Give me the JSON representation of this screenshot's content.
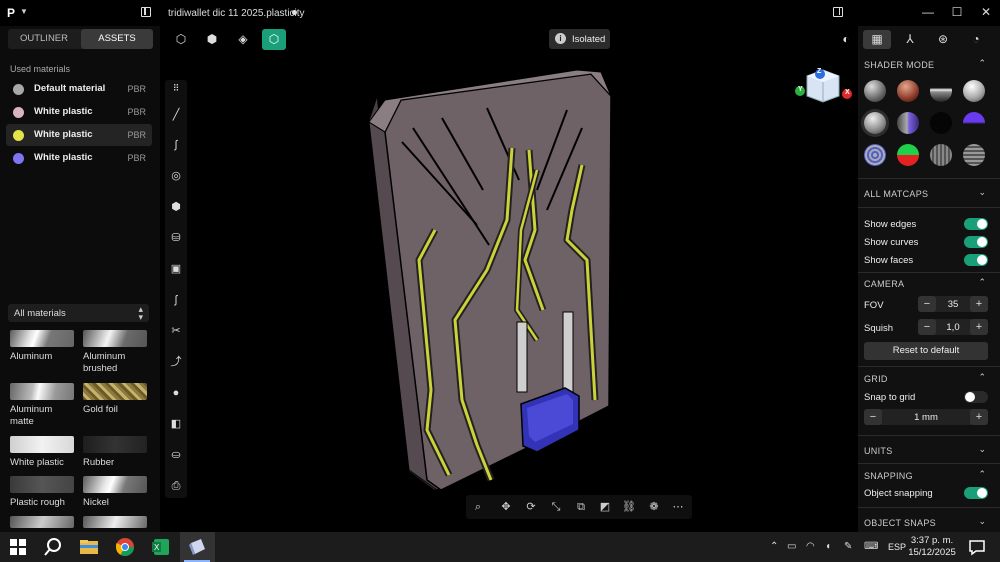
{
  "titlebar": {
    "logo": "P",
    "doc_title": "tridiwallet dic 11 2025.plasticity",
    "min": "—",
    "max": "☐",
    "close": "✕"
  },
  "left_panel": {
    "tabs": [
      {
        "label": "OUTLINER"
      },
      {
        "label": "ASSETS"
      }
    ],
    "used_materials_title": "Used materials",
    "used_materials": [
      {
        "name": "Default material",
        "type": "PBR",
        "color": "#a8a8a8"
      },
      {
        "name": "White plastic",
        "type": "PBR",
        "color": "#d9b3c0"
      },
      {
        "name": "White plastic",
        "type": "PBR",
        "color": "#e3e34a"
      },
      {
        "name": "White plastic",
        "type": "PBR",
        "color": "#7e75f0"
      }
    ],
    "filter": "All materials",
    "library": [
      {
        "name": "Aluminum"
      },
      {
        "name": "Aluminum brushed"
      },
      {
        "name": "Aluminum matte"
      },
      {
        "name": "Gold foil"
      },
      {
        "name": "White plastic"
      },
      {
        "name": "Rubber"
      },
      {
        "name": "Plastic rough"
      },
      {
        "name": "Nickel"
      }
    ]
  },
  "viewport": {
    "isolated_label": "Isolated",
    "gizmo": {
      "x": "X",
      "y": "Y",
      "z": "Z"
    }
  },
  "right_panel": {
    "shader_mode_title": "SHADER MODE",
    "all_matcaps": "ALL MATCAPS",
    "show_edges": "Show edges",
    "show_curves": "Show curves",
    "show_faces": "Show faces",
    "camera_title": "CAMERA",
    "fov_label": "FOV",
    "fov_value": "35",
    "squish_label": "Squish",
    "squish_value": "1,0",
    "reset_label": "Reset to default",
    "grid_title": "GRID",
    "snap_to_grid": "Snap to grid",
    "grid_value": "1 mm",
    "units_title": "UNITS",
    "snapping_title": "SNAPPING",
    "object_snapping": "Object snapping",
    "object_snaps_title": "OBJECT SNAPS",
    "minus": "−",
    "plus": "+"
  },
  "taskbar": {
    "time": "3:37 p. m.",
    "date": "15/12/2025",
    "lang": "ESP"
  }
}
